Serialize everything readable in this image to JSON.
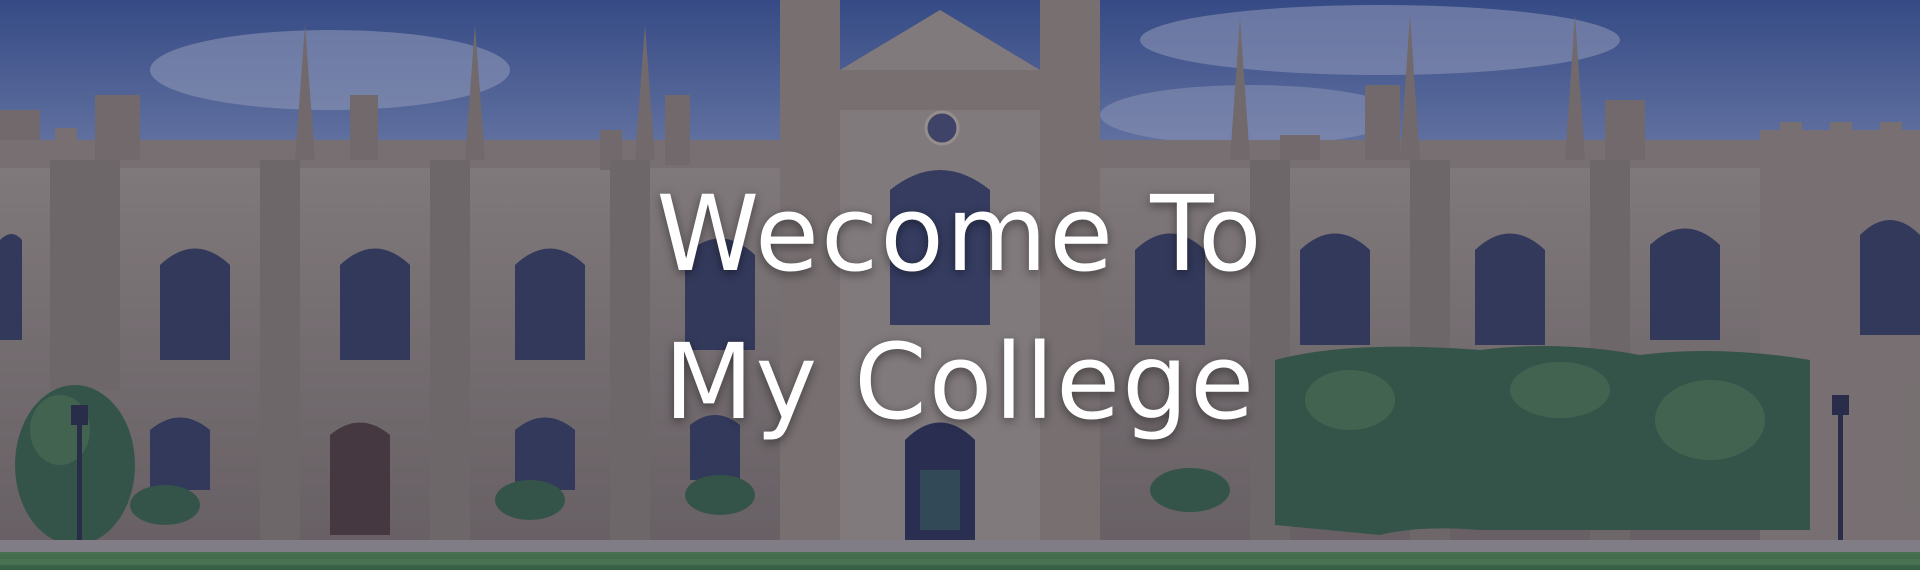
{
  "banner": {
    "headline_line1": "Wecome To",
    "headline_line2": "My College"
  },
  "colors": {
    "sky": "#5b78b4",
    "stone": "#a9957a",
    "overlay": "#283060",
    "ivy": "#3d6b3a",
    "lawn": "#4f8a3c",
    "text": "#ffffff"
  }
}
